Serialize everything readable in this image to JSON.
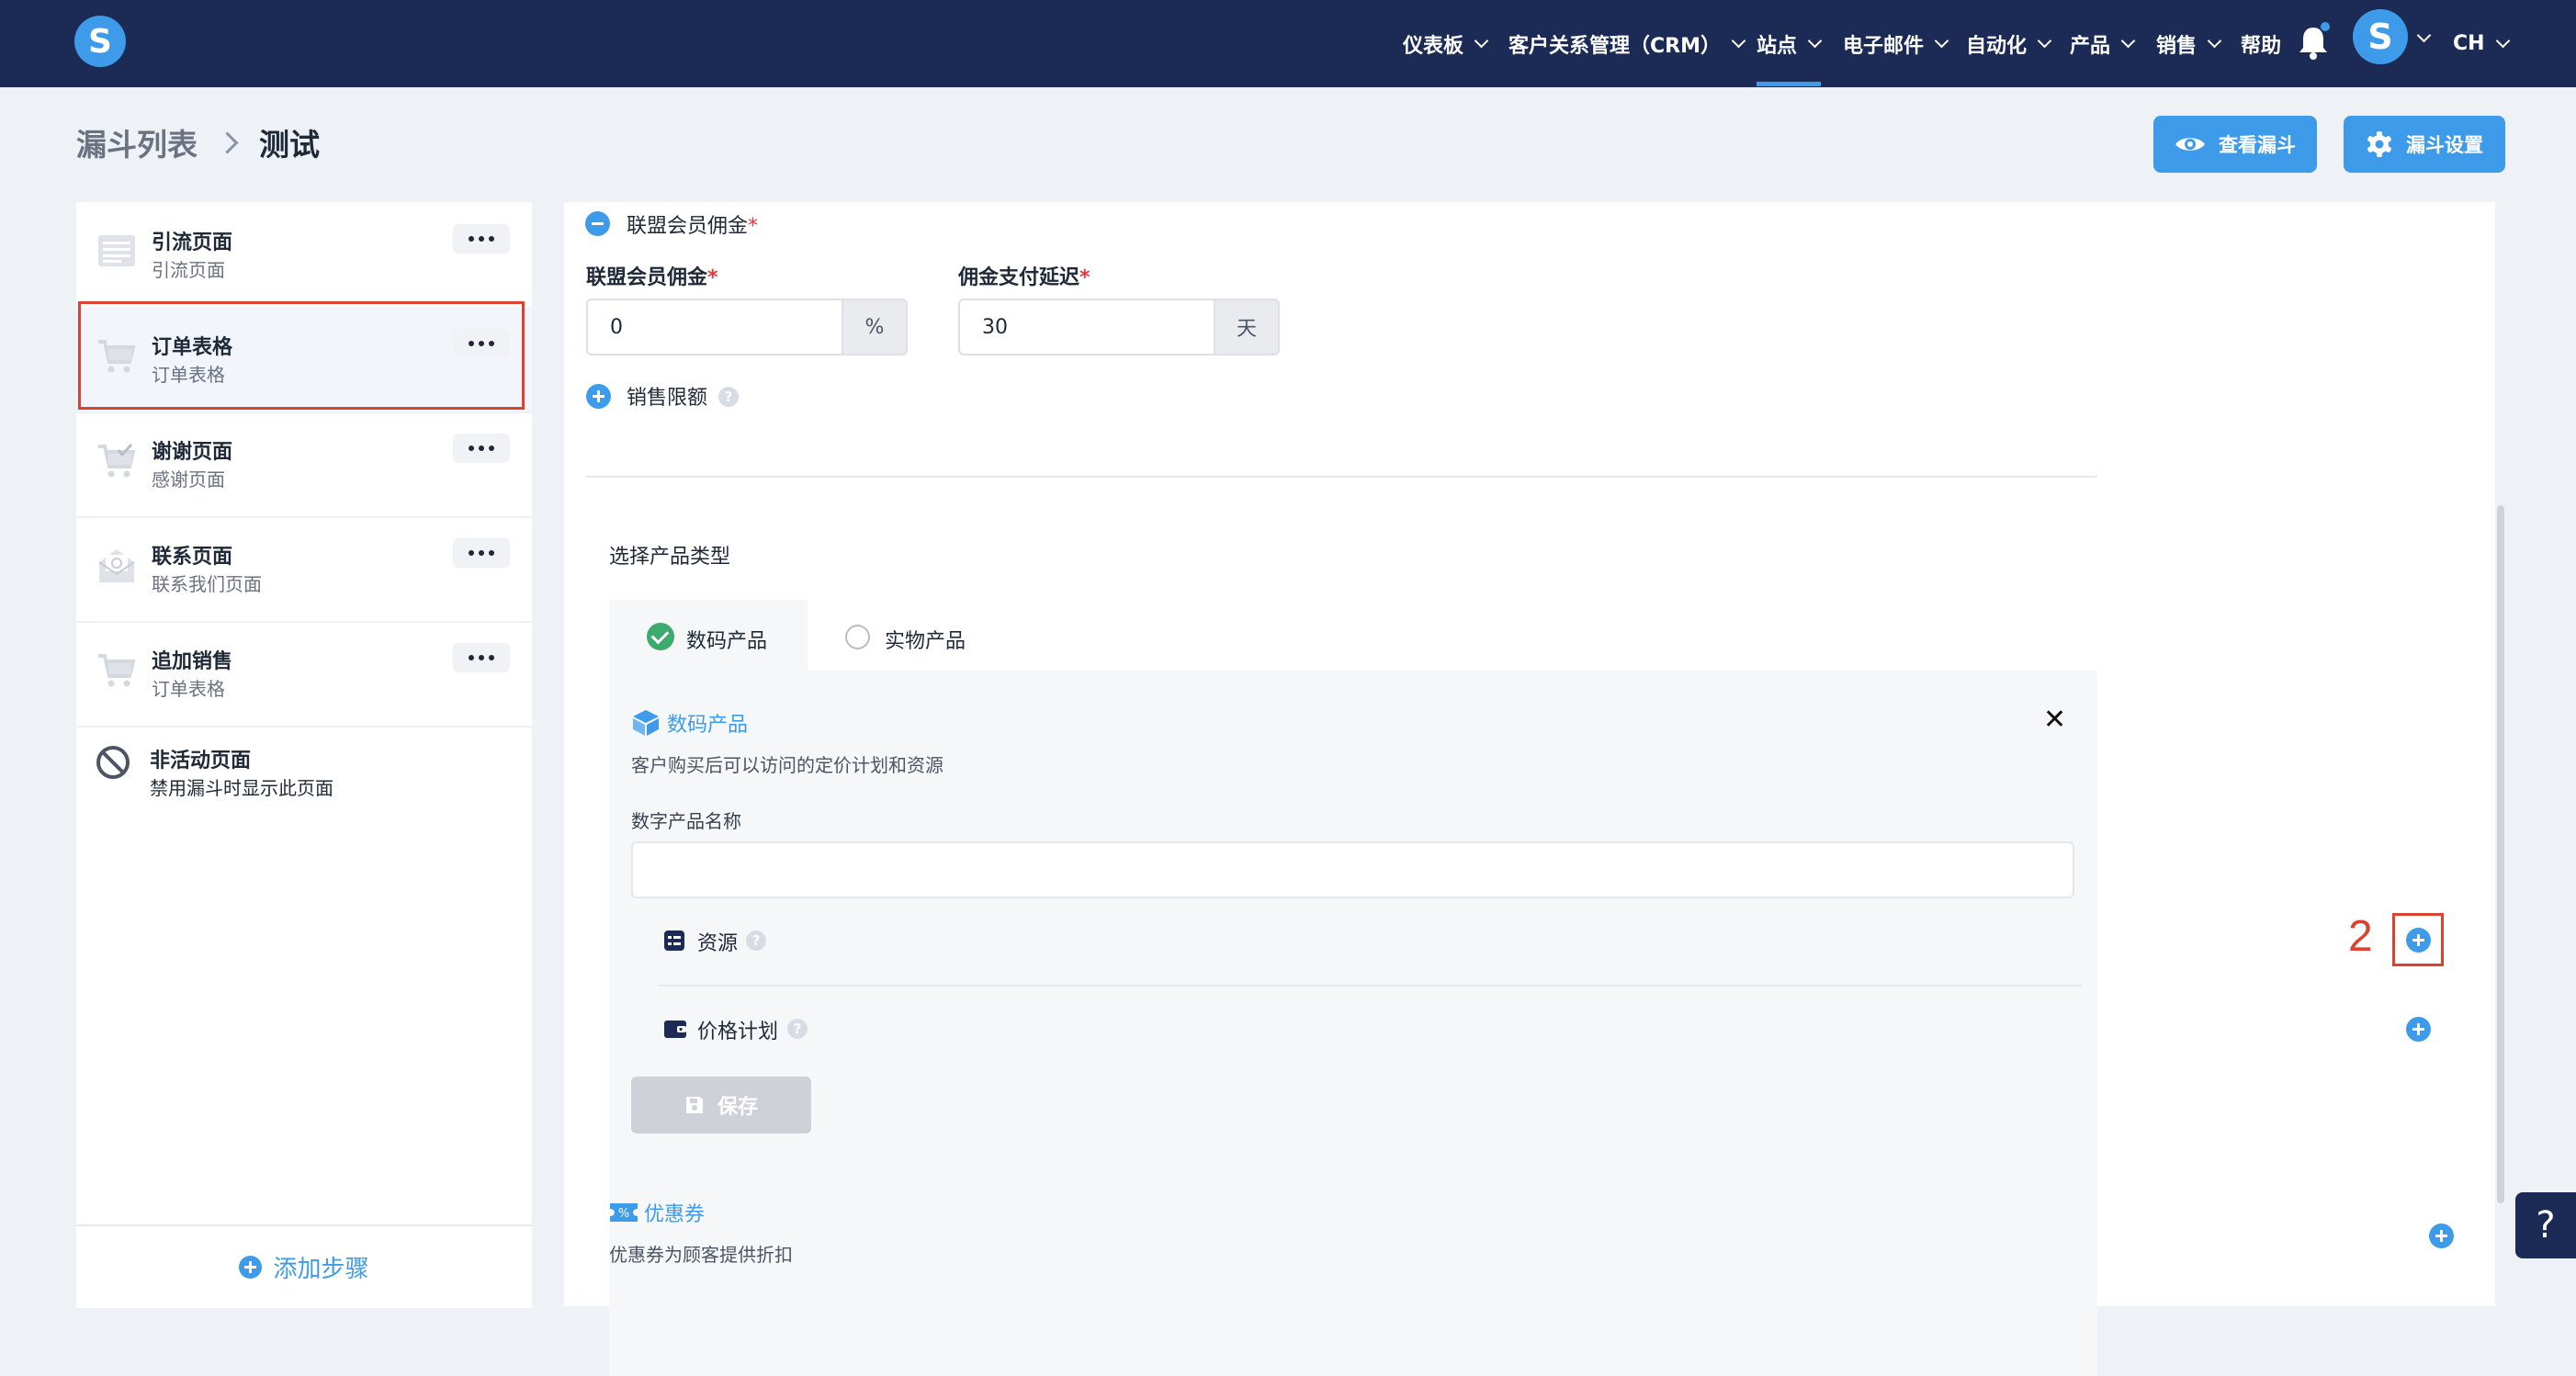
{
  "app": {
    "logo_letter": "S"
  },
  "nav": {
    "items": [
      {
        "label": "仪表板"
      },
      {
        "label": "客户关系管理（CRM）"
      },
      {
        "label": "站点"
      },
      {
        "label": "电子邮件"
      },
      {
        "label": "自动化"
      },
      {
        "label": "产品"
      },
      {
        "label": "销售"
      },
      {
        "label": "帮助"
      }
    ],
    "active": "站点",
    "avatar_letter": "S",
    "language": "CH"
  },
  "breadcrumb": {
    "parent": "漏斗列表",
    "current": "测试"
  },
  "header_buttons": {
    "view_funnel": "查看漏斗",
    "funnel_settings": "漏斗设置"
  },
  "sidebar": {
    "steps": [
      {
        "title": "引流页面",
        "subtitle": "引流页面"
      },
      {
        "title": "订单表格",
        "subtitle": "订单表格"
      },
      {
        "title": "谢谢页面",
        "subtitle": "感谢页面"
      },
      {
        "title": "联系页面",
        "subtitle": "联系我们页面"
      },
      {
        "title": "追加销售",
        "subtitle": "订单表格"
      }
    ],
    "inactive": {
      "title": "非活动页面",
      "subtitle": "禁用漏斗时显示此页面"
    },
    "add_step": "添加步骤"
  },
  "affiliate": {
    "section_label": "联盟会员佣金",
    "commission_label": "联盟会员佣金",
    "commission_value": "0",
    "commission_unit": "%",
    "delay_label": "佣金支付延迟",
    "delay_value": "30",
    "delay_unit": "天",
    "sales_limit_label": "销售限额"
  },
  "product_type": {
    "label": "选择产品类型",
    "tabs": [
      {
        "label": "数码产品",
        "selected": true
      },
      {
        "label": "实物产品",
        "selected": false
      }
    ]
  },
  "digital_product": {
    "title": "数码产品",
    "description": "客户购买后可以访问的定价计划和资源",
    "name_label": "数字产品名称",
    "name_value": "",
    "resources_label": "资源",
    "price_plans_label": "价格计划",
    "save_label": "保存"
  },
  "annotation": {
    "number": "2"
  },
  "coupon": {
    "title": "优惠券",
    "description": "优惠券为顾客提供折扣"
  },
  "help_fab": "?",
  "colors": {
    "nav_bg": "#1b2b55",
    "accent": "#3d9be9",
    "annotation": "#d9432f",
    "success": "#3daa6e"
  }
}
